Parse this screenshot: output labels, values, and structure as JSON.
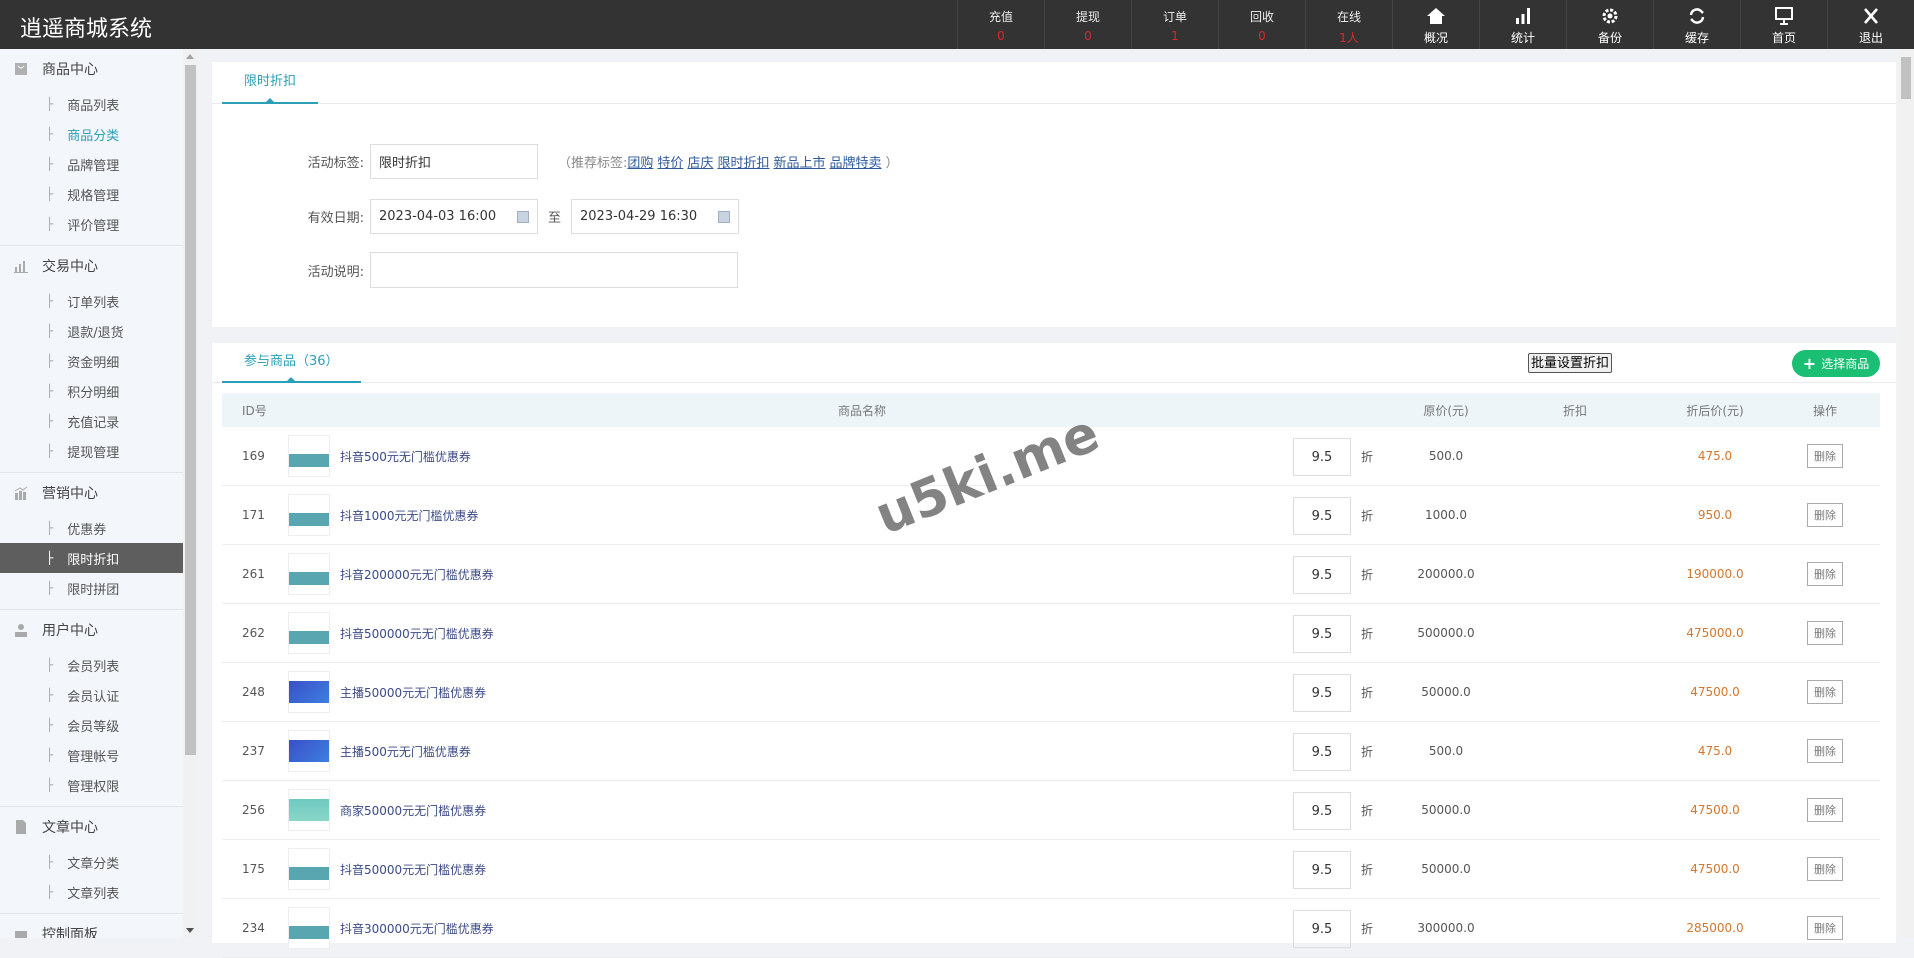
{
  "header": {
    "title": "逍遥商城系统",
    "stats": [
      {
        "label": "充值",
        "value": "0"
      },
      {
        "label": "提现",
        "value": "0"
      },
      {
        "label": "订单",
        "value": "1"
      },
      {
        "label": "回收",
        "value": "0"
      },
      {
        "label": "在线",
        "value": "1人"
      }
    ],
    "actions": [
      {
        "icon": "home-icon",
        "label": "概况"
      },
      {
        "icon": "bar-chart-icon",
        "label": "统计"
      },
      {
        "icon": "gear-icon",
        "label": "备份"
      },
      {
        "icon": "refresh-icon",
        "label": "缓存"
      },
      {
        "icon": "monitor-icon",
        "label": "首页"
      },
      {
        "icon": "close-icon",
        "label": "退出"
      }
    ]
  },
  "sidebar": {
    "groups": [
      {
        "icon": "bag-icon",
        "label": "商品中心",
        "items": [
          "商品列表",
          "商品分类",
          "品牌管理",
          "规格管理",
          "评价管理"
        ]
      },
      {
        "icon": "bar-chart-icon",
        "label": "交易中心",
        "items": [
          "订单列表",
          "退款/退货",
          "资金明细",
          "积分明细",
          "充值记录",
          "提现管理"
        ]
      },
      {
        "icon": "trend-chart-icon",
        "label": "营销中心",
        "items": [
          "优惠券",
          "限时折扣",
          "限时拼团"
        ]
      },
      {
        "icon": "user-icon",
        "label": "用户中心",
        "items": [
          "会员列表",
          "会员认证",
          "会员等级",
          "管理帐号",
          "管理权限"
        ]
      },
      {
        "icon": "document-icon",
        "label": "文章中心",
        "items": [
          "文章分类",
          "文章列表"
        ]
      },
      {
        "icon": "dashboard-icon",
        "label": "控制面板",
        "items": []
      }
    ],
    "active": "限时折扣",
    "hover": "商品分类"
  },
  "form": {
    "tab": "限时折扣",
    "tag_label": "活动标签:",
    "tag_value": "限时折扣",
    "hint_prefix": "（推荐标签:",
    "hint_suffix": "）",
    "suggested_tags": [
      "团购",
      "特价",
      "店庆",
      "限时折扣",
      "新品上市",
      "品牌特卖"
    ],
    "date_label": "有效日期:",
    "start_date": "2023-04-03 16:00",
    "to": "至",
    "end_date": "2023-04-29 16:30",
    "desc_label": "活动说明:",
    "desc_value": ""
  },
  "products": {
    "tab": "参与商品（36）",
    "batch_button": "批量设置折扣",
    "choose_button": "选择商品",
    "columns": {
      "id": "ID号",
      "name": "商品名称",
      "price": "原价(元)",
      "discount": "折扣",
      "after": "折后价(元)",
      "op": "操作"
    },
    "discount_unit": "折",
    "delete_label": "删除",
    "rows": [
      {
        "id": "169",
        "thumb": "douyin",
        "name": "抖音500元无门槛优惠券",
        "price": "500.0",
        "discount": "9.5",
        "after": "475.0"
      },
      {
        "id": "171",
        "thumb": "douyin",
        "name": "抖音1000元无门槛优惠券",
        "price": "1000.0",
        "discount": "9.5",
        "after": "950.0"
      },
      {
        "id": "261",
        "thumb": "douyin",
        "name": "抖音200000元无门槛优惠券",
        "price": "200000.0",
        "discount": "9.5",
        "after": "190000.0"
      },
      {
        "id": "262",
        "thumb": "douyin",
        "name": "抖音500000元无门槛优惠券",
        "price": "500000.0",
        "discount": "9.5",
        "after": "475000.0"
      },
      {
        "id": "248",
        "thumb": "anchor",
        "name": "主播50000元无门槛优惠券",
        "price": "50000.0",
        "discount": "9.5",
        "after": "47500.0"
      },
      {
        "id": "237",
        "thumb": "anchor",
        "name": "主播500元无门槛优惠券",
        "price": "500.0",
        "discount": "9.5",
        "after": "475.0"
      },
      {
        "id": "256",
        "thumb": "merchant",
        "name": "商家50000元无门槛优惠券",
        "price": "50000.0",
        "discount": "9.5",
        "after": "47500.0"
      },
      {
        "id": "175",
        "thumb": "douyin",
        "name": "抖音50000元无门槛优惠券",
        "price": "50000.0",
        "discount": "9.5",
        "after": "47500.0"
      },
      {
        "id": "234",
        "thumb": "douyin",
        "name": "抖音300000元无门槛优惠券",
        "price": "300000.0",
        "discount": "9.5",
        "after": "285000.0"
      }
    ]
  },
  "watermark": "u5ki.me",
  "colors": {
    "accent": "#2a9fb5",
    "green": "#1bbf73",
    "price_after": "#d2772d",
    "stat": "#d62a2a"
  }
}
